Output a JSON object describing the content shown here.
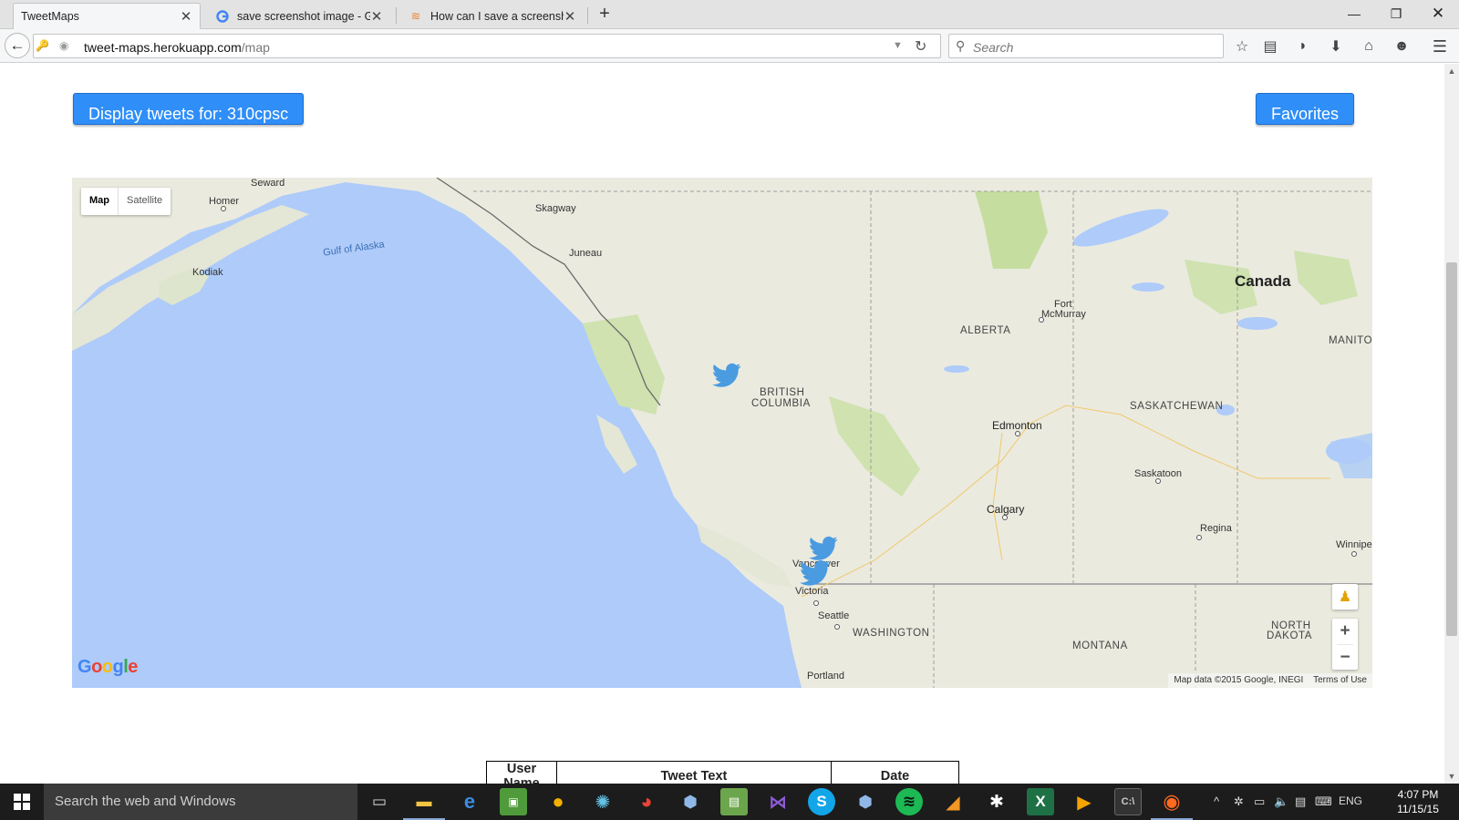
{
  "browser": {
    "tabs": [
      {
        "label": "TweetMaps",
        "favicon": "tweetmaps-favicon",
        "active": true
      },
      {
        "label": "save screenshot image - G...",
        "favicon": "google-favicon",
        "active": false
      },
      {
        "label": "How can I save a screensh...",
        "favicon": "stackoverflow-favicon",
        "active": false
      }
    ],
    "new_tab": "+",
    "url_host": "tweet-maps.herokuapp.com",
    "url_path": "/map",
    "search_placeholder": "Search"
  },
  "page": {
    "display_button_label": "Display tweets for: 310cpsc",
    "favorites_button_label": "Favorites",
    "map": {
      "type_map": "Map",
      "type_satellite": "Satellite",
      "google_logo": "Google",
      "attribution": "Map data ©2015 Google, INEGI",
      "terms": "Terms of Use",
      "labels": {
        "seward": "Seward",
        "homer": "Homer",
        "kodiak": "Kodiak",
        "gulf_of_alaska": "Gulf of Alaska",
        "skagway": "Skagway",
        "juneau": "Juneau",
        "canada": "Canada",
        "fort_mcmurray_1": "Fort",
        "fort_mcmurray_2": "McMurray",
        "alberta": "ALBERTA",
        "manitoba": "MANITO",
        "british_columbia_1": "BRITISH",
        "british_columbia_2": "COLUMBIA",
        "saskatchewan": "SASKATCHEWAN",
        "edmonton": "Edmonton",
        "saskatoon": "Saskatoon",
        "calgary": "Calgary",
        "regina": "Regina",
        "winnipeg": "Winnipe",
        "vancouver": "Vancouver",
        "victoria": "Victoria",
        "seattle": "Seattle",
        "washington": "WASHINGTON",
        "montana": "MONTANA",
        "north_dakota_1": "NORTH",
        "north_dakota_2": "DAKOTA",
        "portland": "Portland"
      },
      "marker_icon": "twitter-bird-icon",
      "colors": {
        "water": "#aecbfa",
        "land": "#eaeadf",
        "park": "#c5dea0",
        "marker": "#4a9be0"
      }
    },
    "table": {
      "headers": [
        "User Name",
        "Tweet Text",
        "Date"
      ]
    }
  },
  "taskbar": {
    "search_placeholder": "Search the web and Windows",
    "language": "ENG",
    "time": "4:07 PM",
    "date": "11/15/15"
  }
}
